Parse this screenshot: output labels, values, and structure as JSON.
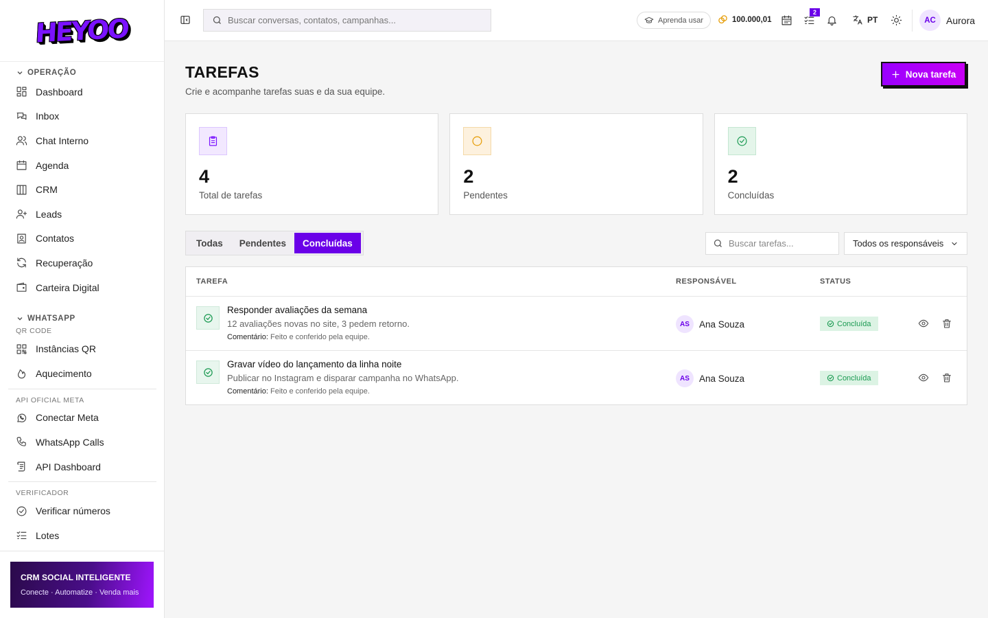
{
  "sidebar": {
    "logo": "HEYOO",
    "sections": {
      "operacao": {
        "title": "OPERAÇÃO",
        "items": [
          "Dashboard",
          "Inbox",
          "Chat Interno",
          "Agenda",
          "CRM",
          "Leads",
          "Contatos",
          "Recuperação",
          "Carteira Digital"
        ]
      },
      "whatsapp": {
        "title": "WHATSAPP",
        "sub": "QR CODE",
        "items": [
          "Instâncias QR",
          "Aquecimento"
        ]
      },
      "api": {
        "title": "API OFICIAL META",
        "items": [
          "Conectar Meta",
          "WhatsApp Calls",
          "API Dashboard"
        ]
      },
      "verificador": {
        "title": "VERIFICADOR",
        "items": [
          "Verificar números",
          "Lotes"
        ]
      }
    },
    "promo": {
      "title": "CRM SOCIAL INTELIGENTE",
      "subtitle": "Conecte · Automatize · Venda mais"
    }
  },
  "topbar": {
    "search_placeholder": "Buscar conversas, contatos, campanhas...",
    "learn_label": "Aprenda usar",
    "coins": "100.000,01",
    "tasks_badge": "2",
    "language": "PT",
    "user_initials": "AC",
    "user_name": "Aurora"
  },
  "page": {
    "title": "TAREFAS",
    "subtitle": "Crie e acompanhe tarefas suas e da sua equipe.",
    "new_button": "Nova tarefa"
  },
  "stats": [
    {
      "value": "4",
      "label": "Total de tarefas",
      "color": "#7a12ff"
    },
    {
      "value": "2",
      "label": "Pendentes",
      "color": "#e59a00"
    },
    {
      "value": "2",
      "label": "Concluídas",
      "color": "#1b9a52"
    }
  ],
  "tabs": [
    "Todas",
    "Pendentes",
    "Concluídas"
  ],
  "active_tab": "Concluídas",
  "filters": {
    "search_placeholder": "Buscar tarefas...",
    "responsible_select": "Todos os responsáveis"
  },
  "table": {
    "headers": {
      "task": "TAREFA",
      "responsible": "RESPONSÁVEL",
      "status": "STATUS"
    },
    "rows": [
      {
        "title": "Responder avaliações da semana",
        "description": "12 avaliações novas no site, 3 pedem retorno.",
        "comment_label": "Comentário:",
        "comment": "Feito e conferido pela equipe.",
        "assignee_initials": "AS",
        "assignee": "Ana Souza",
        "status": "Concluída"
      },
      {
        "title": "Gravar vídeo do lançamento da linha noite",
        "description": "Publicar no Instagram e disparar campanha no WhatsApp.",
        "comment_label": "Comentário:",
        "comment": "Feito e conferido pela equipe.",
        "assignee_initials": "AS",
        "assignee": "Ana Souza",
        "status": "Concluída"
      }
    ]
  },
  "colors": {
    "accent": "#6a00e8",
    "success": "#1b9a52",
    "warning": "#e59a00"
  }
}
